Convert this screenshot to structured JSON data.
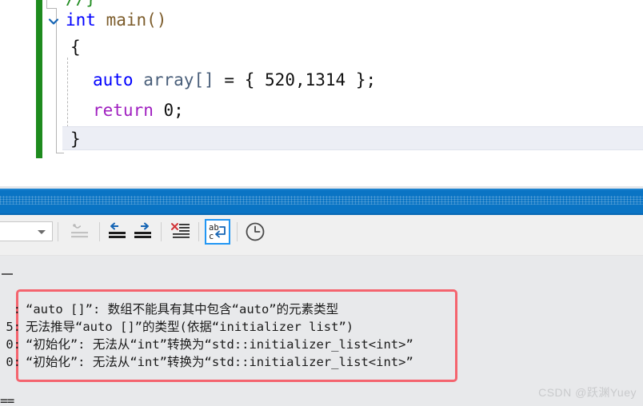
{
  "editor": {
    "name": "code-editor",
    "cut_off_line": "//}",
    "lines": [
      {
        "id": "main",
        "text": "int main()"
      },
      {
        "id": "open",
        "text": "{"
      },
      {
        "id": "decl",
        "text": "auto array[] = { 520,1314 };"
      },
      {
        "id": "return",
        "text": "return 0;"
      },
      {
        "id": "close",
        "text": "}"
      }
    ],
    "tokens": {
      "kw_int": "int",
      "fn_main": "main()",
      "brace_open": "{",
      "kw_auto": "auto",
      "ident_array": "array[]",
      "op_assign": "=",
      "init_open": "{",
      "value_1": "520",
      "comma": ",",
      "value_2": "1314",
      "init_close": "}",
      "semicolon": ";",
      "kw_return": "return",
      "literal_zero": "0",
      "return_semicolon": ";",
      "brace_close": "}"
    },
    "colors": {
      "keyword": "#0000ff",
      "keyword_purple": "#a020c0",
      "function": "#7c5c2b",
      "identifier": "#4a5f7a",
      "plain": "#111111",
      "change_bar": "#1e8b1e",
      "squiggle": "#e81123"
    }
  },
  "progress_band": {
    "name": "build-progress-band",
    "color": "#0a74c4"
  },
  "toolbar": {
    "name": "output-toolbar",
    "combo_value": "",
    "combo_placeholder": "",
    "buttons": [
      {
        "id": "clear-all",
        "icon": "clear-output-icon",
        "label": "Clear All",
        "enabled": false,
        "active": false
      },
      {
        "id": "go-to-previous",
        "icon": "arrow-left-icon",
        "label": "Go To Previous Message",
        "enabled": true,
        "active": false
      },
      {
        "id": "go-to-next",
        "icon": "arrow-right-icon",
        "label": "Go To Next Message",
        "enabled": true,
        "active": false
      },
      {
        "id": "clear-pane",
        "icon": "clear-pane-icon",
        "label": "Clear Pane",
        "enabled": true,
        "active": false
      },
      {
        "id": "toggle-word-wrap",
        "icon": "word-wrap-icon",
        "label": "Toggle Word Wrap",
        "enabled": true,
        "active": true
      },
      {
        "id": "show-timestamps",
        "icon": "clock-icon",
        "label": "Show Timestamps",
        "enabled": true,
        "active": false
      }
    ],
    "accent_color": "#2196f3"
  },
  "output": {
    "name": "output-pane",
    "top_marker": "—",
    "bottom_marker": "==",
    "error_box_color": "#f4646e",
    "messages": [
      {
        "prefix": ":",
        "text": "“auto []”: 数组不能具有其中包含“auto”的元素类型"
      },
      {
        "prefix": "5:",
        "text": "无法推导“auto []”的类型(依据“initializer list”)"
      },
      {
        "prefix": "0:",
        "text": "“初始化”: 无法从“int”转换为“std::initializer_list<int>”"
      },
      {
        "prefix": "0:",
        "text": "“初始化”: 无法从“int”转换为“std::initializer_list<int>”"
      }
    ]
  },
  "watermark": {
    "name": "csdn-watermark",
    "text": "CSDN @跃渊Yuey"
  }
}
